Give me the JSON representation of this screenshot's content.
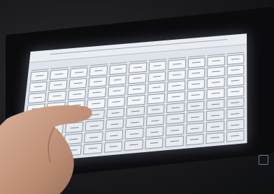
{
  "scene": {
    "colors": {
      "room": "#1a1a1d",
      "bezel": "#0b0b0d",
      "screen": "#dfe3ea",
      "skin": "#c89a80"
    },
    "grid": {
      "columns": 11,
      "rows": 8
    }
  }
}
